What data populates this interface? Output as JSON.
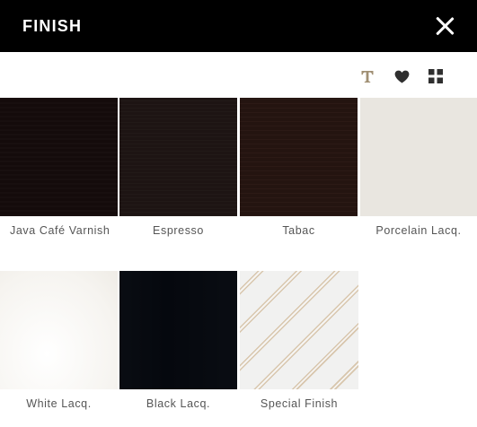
{
  "header": {
    "title": "FINISH",
    "close_icon": "close-icon"
  },
  "toolbar": {
    "icons": [
      "text-icon",
      "heart-icon",
      "grid-icon"
    ],
    "accent_color": "#a08f73"
  },
  "finishes": [
    {
      "label": "Java Café Varnish",
      "color": "#140b0b"
    },
    {
      "label": "Espresso",
      "color": "#1d1413"
    },
    {
      "label": "Tabac",
      "color": "#241410"
    },
    {
      "label": "Porcelain Lacq.",
      "color": "#e9e6e0"
    },
    {
      "label": "White Lacq.",
      "color": "#f6f4f0"
    },
    {
      "label": "Black Lacq.",
      "color": "#05080e"
    },
    {
      "label": "Special Finish",
      "color": "#d8c6ad"
    }
  ]
}
